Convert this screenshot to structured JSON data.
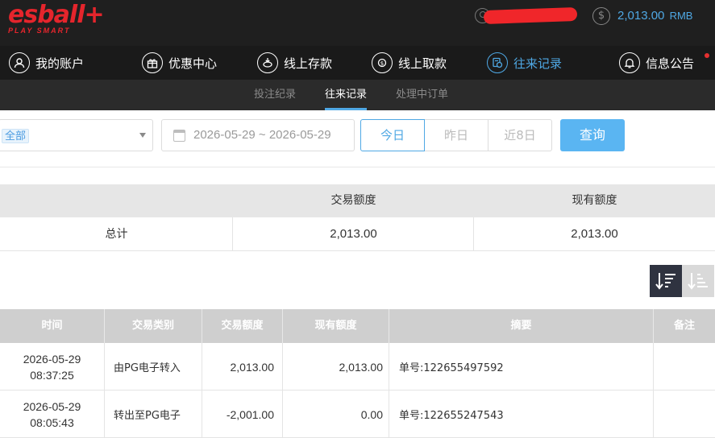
{
  "header": {
    "logo": "esball+",
    "logo_tagline": "PLAY SMART",
    "balance": "2,013.00",
    "currency": "RMB",
    "colors": {
      "background": "#1f1f1f",
      "accent": "#4fa8e4",
      "brand": "#e5252c"
    }
  },
  "nav": {
    "items": [
      {
        "label": "我的账户",
        "icon": "user-circle-icon"
      },
      {
        "label": "优惠中心",
        "icon": "gift-icon"
      },
      {
        "label": "线上存款",
        "icon": "deposit-icon"
      },
      {
        "label": "线上取款",
        "icon": "withdraw-icon"
      },
      {
        "label": "往来记录",
        "icon": "records-icon",
        "active": true
      },
      {
        "label": "信息公告",
        "icon": "bell-icon"
      }
    ]
  },
  "subnav": {
    "items": [
      {
        "label": "投注纪录"
      },
      {
        "label": "往来记录",
        "active": true
      },
      {
        "label": "处理中订单"
      }
    ]
  },
  "filters": {
    "type_select": "全部",
    "date_range": "2026-05-29 ~ 2026-05-29",
    "quick_ranges": [
      "今日",
      "昨日",
      "近8日"
    ],
    "active_range": "今日",
    "query_label": "查询"
  },
  "summary": {
    "headers": [
      "交易额度",
      "现有额度"
    ],
    "row_label": "总计",
    "transaction_amount": "2,013.00",
    "current_amount": "2,013.00"
  },
  "table": {
    "headers": [
      "时间",
      "交易类别",
      "交易额度",
      "现有额度",
      "摘要",
      "备注"
    ],
    "rows": [
      {
        "date": "2026-05-29",
        "time": "08:37:25",
        "type": "由PG电子转入",
        "amount": "2,013.00",
        "balance": "2,013.00",
        "summary": "单号:122655497592",
        "note": ""
      },
      {
        "date": "2026-05-29",
        "time": "08:05:43",
        "type": "转出至PG电子",
        "amount": "-2,001.00",
        "balance": "0.00",
        "summary": "单号:122655247543",
        "note": ""
      }
    ]
  }
}
